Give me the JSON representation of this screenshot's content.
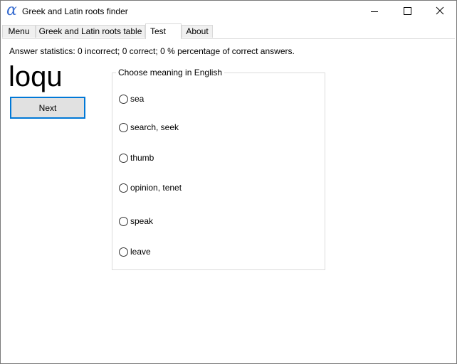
{
  "window": {
    "app_icon_glyph": "α",
    "title": "Greek and Latin roots finder"
  },
  "tabs": [
    {
      "label": "Menu"
    },
    {
      "label": "Greek and Latin roots table"
    },
    {
      "label": "Test"
    },
    {
      "label": "About"
    }
  ],
  "active_tab": "Test",
  "test": {
    "statistics": "Answer statistics: 0 incorrect; 0 correct; 0 % percentage of correct answers.",
    "root": "loqu",
    "next_label": "Next",
    "group_title": "Choose meaning in English",
    "options": [
      {
        "label": "sea",
        "selected": false
      },
      {
        "label": "search, seek",
        "selected": false
      },
      {
        "label": "thumb",
        "selected": false
      },
      {
        "label": "opinion, tenet",
        "selected": false
      },
      {
        "label": "speak",
        "selected": false
      },
      {
        "label": "leave",
        "selected": false
      }
    ]
  },
  "colors": {
    "accent": "#0078d7",
    "app_icon": "#3b6fd1",
    "tab_inactive": "#f0f0f0",
    "button_face": "#e1e1e1"
  },
  "icons": {
    "app": "alpha-icon",
    "minimize": "minimize-icon",
    "maximize": "maximize-icon",
    "close": "close-icon",
    "radio": "radio-unchecked-icon"
  }
}
